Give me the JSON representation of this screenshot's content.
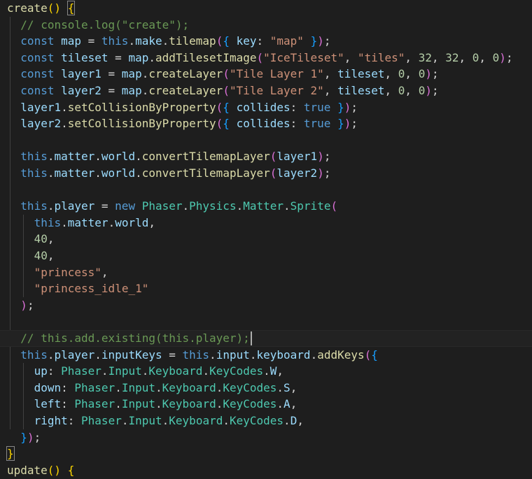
{
  "colors": {
    "background": "#1e1e1e",
    "keyword": "#569cd6",
    "function": "#dcdcaa",
    "variable": "#9cdcfe",
    "class": "#4ec9b0",
    "string": "#ce9178",
    "number": "#b5cea8",
    "comment": "#6a9955",
    "punct": "#d4d4d4",
    "bracket1": "#ffd700",
    "bracket2": "#da70d6",
    "bracket3": "#179fff"
  },
  "code_lines": [
    {
      "indent": 0,
      "tokens": [
        {
          "t": "create",
          "c": "function"
        },
        {
          "t": "() ",
          "c": "bracket1"
        },
        {
          "t": "{",
          "c": "bracket1",
          "box": true
        }
      ]
    },
    {
      "indent": 1,
      "tokens": [
        {
          "t": "// console.log(\"create\");",
          "c": "comment"
        }
      ]
    },
    {
      "indent": 1,
      "tokens": [
        {
          "t": "const ",
          "c": "keyword"
        },
        {
          "t": "map",
          "c": "variable"
        },
        {
          "t": " = ",
          "c": "punct"
        },
        {
          "t": "this",
          "c": "keyword"
        },
        {
          "t": ".",
          "c": "punct"
        },
        {
          "t": "make",
          "c": "variable"
        },
        {
          "t": ".",
          "c": "punct"
        },
        {
          "t": "tilemap",
          "c": "function"
        },
        {
          "t": "(",
          "c": "bracket2"
        },
        {
          "t": "{",
          "c": "bracket3"
        },
        {
          "t": " key",
          "c": "variable"
        },
        {
          "t": ": ",
          "c": "punct"
        },
        {
          "t": "\"map\"",
          "c": "string"
        },
        {
          "t": " }",
          "c": "bracket3"
        },
        {
          "t": ")",
          "c": "bracket2"
        },
        {
          "t": ";",
          "c": "punct"
        }
      ]
    },
    {
      "indent": 1,
      "tokens": [
        {
          "t": "const ",
          "c": "keyword"
        },
        {
          "t": "tileset",
          "c": "variable"
        },
        {
          "t": " = ",
          "c": "punct"
        },
        {
          "t": "map",
          "c": "variable"
        },
        {
          "t": ".",
          "c": "punct"
        },
        {
          "t": "addTilesetImage",
          "c": "function"
        },
        {
          "t": "(",
          "c": "bracket2"
        },
        {
          "t": "\"IceTileset\"",
          "c": "string"
        },
        {
          "t": ", ",
          "c": "punct"
        },
        {
          "t": "\"tiles\"",
          "c": "string"
        },
        {
          "t": ", ",
          "c": "punct"
        },
        {
          "t": "32",
          "c": "number"
        },
        {
          "t": ", ",
          "c": "punct"
        },
        {
          "t": "32",
          "c": "number"
        },
        {
          "t": ", ",
          "c": "punct"
        },
        {
          "t": "0",
          "c": "number"
        },
        {
          "t": ", ",
          "c": "punct"
        },
        {
          "t": "0",
          "c": "number"
        },
        {
          "t": ")",
          "c": "bracket2"
        },
        {
          "t": ";",
          "c": "punct"
        }
      ]
    },
    {
      "indent": 1,
      "tokens": [
        {
          "t": "const ",
          "c": "keyword"
        },
        {
          "t": "layer1",
          "c": "variable"
        },
        {
          "t": " = ",
          "c": "punct"
        },
        {
          "t": "map",
          "c": "variable"
        },
        {
          "t": ".",
          "c": "punct"
        },
        {
          "t": "createLayer",
          "c": "function"
        },
        {
          "t": "(",
          "c": "bracket2"
        },
        {
          "t": "\"Tile Layer 1\"",
          "c": "string"
        },
        {
          "t": ", ",
          "c": "punct"
        },
        {
          "t": "tileset",
          "c": "variable"
        },
        {
          "t": ", ",
          "c": "punct"
        },
        {
          "t": "0",
          "c": "number"
        },
        {
          "t": ", ",
          "c": "punct"
        },
        {
          "t": "0",
          "c": "number"
        },
        {
          "t": ")",
          "c": "bracket2"
        },
        {
          "t": ";",
          "c": "punct"
        }
      ]
    },
    {
      "indent": 1,
      "tokens": [
        {
          "t": "const ",
          "c": "keyword"
        },
        {
          "t": "layer2",
          "c": "variable"
        },
        {
          "t": " = ",
          "c": "punct"
        },
        {
          "t": "map",
          "c": "variable"
        },
        {
          "t": ".",
          "c": "punct"
        },
        {
          "t": "createLayer",
          "c": "function"
        },
        {
          "t": "(",
          "c": "bracket2"
        },
        {
          "t": "\"Tile Layer 2\"",
          "c": "string"
        },
        {
          "t": ", ",
          "c": "punct"
        },
        {
          "t": "tileset",
          "c": "variable"
        },
        {
          "t": ", ",
          "c": "punct"
        },
        {
          "t": "0",
          "c": "number"
        },
        {
          "t": ", ",
          "c": "punct"
        },
        {
          "t": "0",
          "c": "number"
        },
        {
          "t": ")",
          "c": "bracket2"
        },
        {
          "t": ";",
          "c": "punct"
        }
      ]
    },
    {
      "indent": 1,
      "tokens": [
        {
          "t": "layer1",
          "c": "variable"
        },
        {
          "t": ".",
          "c": "punct"
        },
        {
          "t": "setCollisionByProperty",
          "c": "function"
        },
        {
          "t": "(",
          "c": "bracket2"
        },
        {
          "t": "{",
          "c": "bracket3"
        },
        {
          "t": " collides",
          "c": "variable"
        },
        {
          "t": ": ",
          "c": "punct"
        },
        {
          "t": "true",
          "c": "keyword"
        },
        {
          "t": " }",
          "c": "bracket3"
        },
        {
          "t": ")",
          "c": "bracket2"
        },
        {
          "t": ";",
          "c": "punct"
        }
      ]
    },
    {
      "indent": 1,
      "tokens": [
        {
          "t": "layer2",
          "c": "variable"
        },
        {
          "t": ".",
          "c": "punct"
        },
        {
          "t": "setCollisionByProperty",
          "c": "function"
        },
        {
          "t": "(",
          "c": "bracket2"
        },
        {
          "t": "{",
          "c": "bracket3"
        },
        {
          "t": " collides",
          "c": "variable"
        },
        {
          "t": ": ",
          "c": "punct"
        },
        {
          "t": "true",
          "c": "keyword"
        },
        {
          "t": " }",
          "c": "bracket3"
        },
        {
          "t": ")",
          "c": "bracket2"
        },
        {
          "t": ";",
          "c": "punct"
        }
      ]
    },
    {
      "indent": 1,
      "tokens": []
    },
    {
      "indent": 1,
      "tokens": [
        {
          "t": "this",
          "c": "keyword"
        },
        {
          "t": ".",
          "c": "punct"
        },
        {
          "t": "matter",
          "c": "variable"
        },
        {
          "t": ".",
          "c": "punct"
        },
        {
          "t": "world",
          "c": "variable"
        },
        {
          "t": ".",
          "c": "punct"
        },
        {
          "t": "convertTilemapLayer",
          "c": "function"
        },
        {
          "t": "(",
          "c": "bracket2"
        },
        {
          "t": "layer1",
          "c": "variable"
        },
        {
          "t": ")",
          "c": "bracket2"
        },
        {
          "t": ";",
          "c": "punct"
        }
      ]
    },
    {
      "indent": 1,
      "tokens": [
        {
          "t": "this",
          "c": "keyword"
        },
        {
          "t": ".",
          "c": "punct"
        },
        {
          "t": "matter",
          "c": "variable"
        },
        {
          "t": ".",
          "c": "punct"
        },
        {
          "t": "world",
          "c": "variable"
        },
        {
          "t": ".",
          "c": "punct"
        },
        {
          "t": "convertTilemapLayer",
          "c": "function"
        },
        {
          "t": "(",
          "c": "bracket2"
        },
        {
          "t": "layer2",
          "c": "variable"
        },
        {
          "t": ")",
          "c": "bracket2"
        },
        {
          "t": ";",
          "c": "punct"
        }
      ]
    },
    {
      "indent": 1,
      "tokens": []
    },
    {
      "indent": 1,
      "tokens": [
        {
          "t": "this",
          "c": "keyword"
        },
        {
          "t": ".",
          "c": "punct"
        },
        {
          "t": "player",
          "c": "variable"
        },
        {
          "t": " = ",
          "c": "punct"
        },
        {
          "t": "new ",
          "c": "keyword"
        },
        {
          "t": "Phaser",
          "c": "class"
        },
        {
          "t": ".",
          "c": "punct"
        },
        {
          "t": "Physics",
          "c": "class"
        },
        {
          "t": ".",
          "c": "punct"
        },
        {
          "t": "Matter",
          "c": "class"
        },
        {
          "t": ".",
          "c": "punct"
        },
        {
          "t": "Sprite",
          "c": "class"
        },
        {
          "t": "(",
          "c": "bracket2"
        }
      ]
    },
    {
      "indent": 2,
      "tokens": [
        {
          "t": "this",
          "c": "keyword"
        },
        {
          "t": ".",
          "c": "punct"
        },
        {
          "t": "matter",
          "c": "variable"
        },
        {
          "t": ".",
          "c": "punct"
        },
        {
          "t": "world",
          "c": "variable"
        },
        {
          "t": ",",
          "c": "punct"
        }
      ]
    },
    {
      "indent": 2,
      "tokens": [
        {
          "t": "40",
          "c": "number"
        },
        {
          "t": ",",
          "c": "punct"
        }
      ]
    },
    {
      "indent": 2,
      "tokens": [
        {
          "t": "40",
          "c": "number"
        },
        {
          "t": ",",
          "c": "punct"
        }
      ]
    },
    {
      "indent": 2,
      "tokens": [
        {
          "t": "\"princess\"",
          "c": "string"
        },
        {
          "t": ",",
          "c": "punct"
        }
      ]
    },
    {
      "indent": 2,
      "tokens": [
        {
          "t": "\"princess_idle_1\"",
          "c": "string"
        }
      ]
    },
    {
      "indent": 1,
      "tokens": [
        {
          "t": ")",
          "c": "bracket2"
        },
        {
          "t": ";",
          "c": "punct"
        }
      ]
    },
    {
      "indent": 1,
      "tokens": []
    },
    {
      "indent": 1,
      "tokens": [
        {
          "t": "// this.add.existing(this.player);",
          "c": "comment"
        }
      ],
      "current": true
    },
    {
      "indent": 1,
      "tokens": [
        {
          "t": "this",
          "c": "keyword"
        },
        {
          "t": ".",
          "c": "punct"
        },
        {
          "t": "player",
          "c": "variable"
        },
        {
          "t": ".",
          "c": "punct"
        },
        {
          "t": "inputKeys",
          "c": "variable"
        },
        {
          "t": " = ",
          "c": "punct"
        },
        {
          "t": "this",
          "c": "keyword"
        },
        {
          "t": ".",
          "c": "punct"
        },
        {
          "t": "input",
          "c": "variable"
        },
        {
          "t": ".",
          "c": "punct"
        },
        {
          "t": "keyboard",
          "c": "variable"
        },
        {
          "t": ".",
          "c": "punct"
        },
        {
          "t": "addKeys",
          "c": "function"
        },
        {
          "t": "(",
          "c": "bracket2"
        },
        {
          "t": "{",
          "c": "bracket3"
        }
      ]
    },
    {
      "indent": 2,
      "tokens": [
        {
          "t": "up",
          "c": "variable"
        },
        {
          "t": ": ",
          "c": "punct"
        },
        {
          "t": "Phaser",
          "c": "class"
        },
        {
          "t": ".",
          "c": "punct"
        },
        {
          "t": "Input",
          "c": "class"
        },
        {
          "t": ".",
          "c": "punct"
        },
        {
          "t": "Keyboard",
          "c": "class"
        },
        {
          "t": ".",
          "c": "punct"
        },
        {
          "t": "KeyCodes",
          "c": "class"
        },
        {
          "t": ".",
          "c": "punct"
        },
        {
          "t": "W",
          "c": "variable"
        },
        {
          "t": ",",
          "c": "punct"
        }
      ]
    },
    {
      "indent": 2,
      "tokens": [
        {
          "t": "down",
          "c": "variable"
        },
        {
          "t": ": ",
          "c": "punct"
        },
        {
          "t": "Phaser",
          "c": "class"
        },
        {
          "t": ".",
          "c": "punct"
        },
        {
          "t": "Input",
          "c": "class"
        },
        {
          "t": ".",
          "c": "punct"
        },
        {
          "t": "Keyboard",
          "c": "class"
        },
        {
          "t": ".",
          "c": "punct"
        },
        {
          "t": "KeyCodes",
          "c": "class"
        },
        {
          "t": ".",
          "c": "punct"
        },
        {
          "t": "S",
          "c": "variable"
        },
        {
          "t": ",",
          "c": "punct"
        }
      ]
    },
    {
      "indent": 2,
      "tokens": [
        {
          "t": "left",
          "c": "variable"
        },
        {
          "t": ": ",
          "c": "punct"
        },
        {
          "t": "Phaser",
          "c": "class"
        },
        {
          "t": ".",
          "c": "punct"
        },
        {
          "t": "Input",
          "c": "class"
        },
        {
          "t": ".",
          "c": "punct"
        },
        {
          "t": "Keyboard",
          "c": "class"
        },
        {
          "t": ".",
          "c": "punct"
        },
        {
          "t": "KeyCodes",
          "c": "class"
        },
        {
          "t": ".",
          "c": "punct"
        },
        {
          "t": "A",
          "c": "variable"
        },
        {
          "t": ",",
          "c": "punct"
        }
      ]
    },
    {
      "indent": 2,
      "tokens": [
        {
          "t": "right",
          "c": "variable"
        },
        {
          "t": ": ",
          "c": "punct"
        },
        {
          "t": "Phaser",
          "c": "class"
        },
        {
          "t": ".",
          "c": "punct"
        },
        {
          "t": "Input",
          "c": "class"
        },
        {
          "t": ".",
          "c": "punct"
        },
        {
          "t": "Keyboard",
          "c": "class"
        },
        {
          "t": ".",
          "c": "punct"
        },
        {
          "t": "KeyCodes",
          "c": "class"
        },
        {
          "t": ".",
          "c": "punct"
        },
        {
          "t": "D",
          "c": "variable"
        },
        {
          "t": ",",
          "c": "punct"
        }
      ]
    },
    {
      "indent": 1,
      "tokens": [
        {
          "t": "}",
          "c": "bracket3"
        },
        {
          "t": ")",
          "c": "bracket2"
        },
        {
          "t": ";",
          "c": "punct"
        }
      ]
    },
    {
      "indent": 0,
      "tokens": [
        {
          "t": "}",
          "c": "bracket1",
          "box": true
        }
      ]
    },
    {
      "indent": 0,
      "tokens": [
        {
          "t": "update",
          "c": "function"
        },
        {
          "t": "() ",
          "c": "bracket1"
        },
        {
          "t": "{",
          "c": "bracket1"
        }
      ]
    }
  ]
}
